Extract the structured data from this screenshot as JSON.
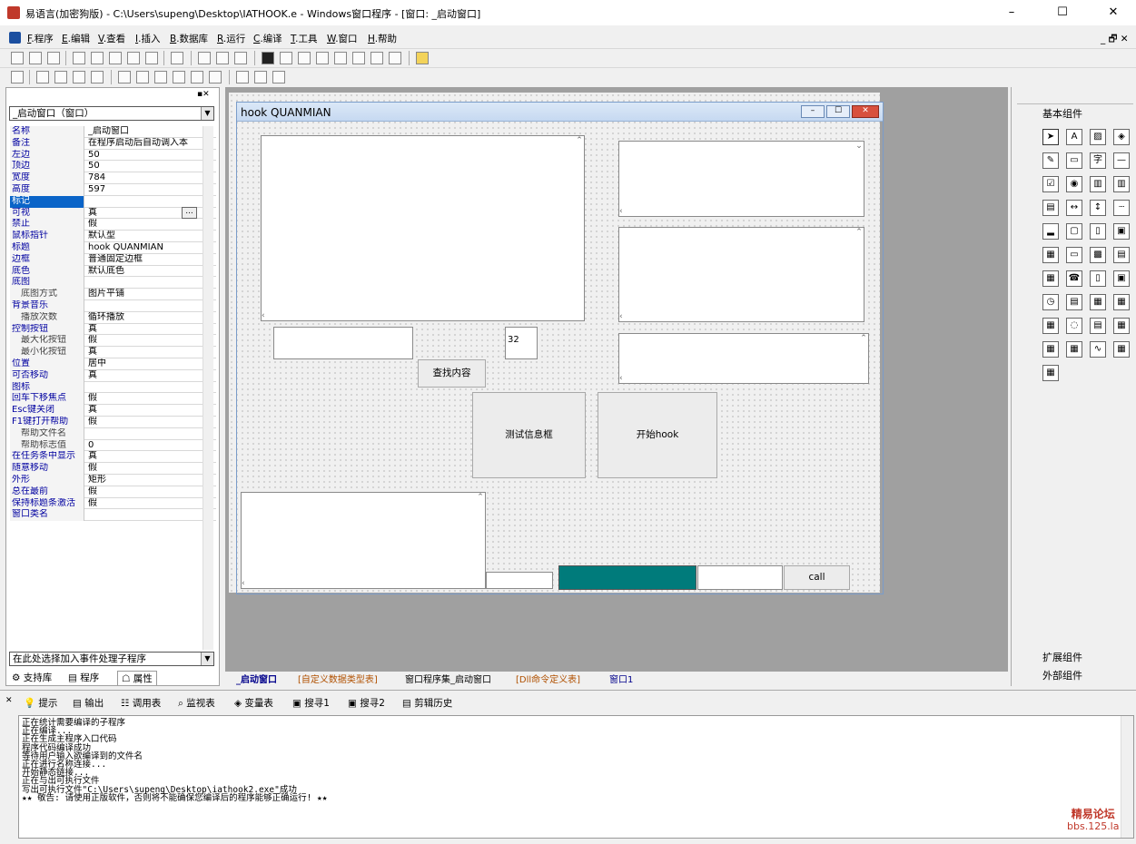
{
  "window": {
    "title": "易语言(加密狗版) - C:\\Users\\supeng\\Desktop\\IATHOOK.e - Windows窗口程序 - [窗口: _启动窗口]",
    "min": "–",
    "max": "☐",
    "close": "✕"
  },
  "menu": [
    {
      "key": "F",
      "label": ".程序"
    },
    {
      "key": "E",
      "label": ".编辑"
    },
    {
      "key": "V",
      "label": ".查看"
    },
    {
      "key": "I",
      "label": ".插入"
    },
    {
      "key": "B",
      "label": ".数据库"
    },
    {
      "key": "R",
      "label": ".运行"
    },
    {
      "key": "C",
      "label": ".编译"
    },
    {
      "key": "T",
      "label": ".工具"
    },
    {
      "key": "W",
      "label": ".窗口"
    },
    {
      "key": "H",
      "label": ".帮助"
    }
  ],
  "menu_right": "_ 🗗 ✕",
  "left": {
    "combo": "_启动窗口（窗口）",
    "props": [
      {
        "n": "名称",
        "v": "_启动窗口"
      },
      {
        "n": "备注",
        "v": "在程序启动后自动调入本"
      },
      {
        "n": "左边",
        "v": "50"
      },
      {
        "n": "顶边",
        "v": "50"
      },
      {
        "n": "宽度",
        "v": "784"
      },
      {
        "n": "高度",
        "v": "597"
      },
      {
        "n": "标记",
        "v": ""
      },
      {
        "n": "可视",
        "v": "真"
      },
      {
        "n": "禁止",
        "v": "假"
      },
      {
        "n": "鼠标指针",
        "v": "默认型"
      },
      {
        "n": "标题",
        "v": "hook QUANMIAN"
      },
      {
        "n": "边框",
        "v": "普通固定边框"
      },
      {
        "n": "底色",
        "v": "默认底色"
      },
      {
        "n": "底图",
        "v": ""
      },
      {
        "n": "底图方式",
        "v": "图片平铺"
      },
      {
        "n": "背景音乐",
        "v": ""
      },
      {
        "n": "播放次数",
        "v": "循环播放"
      },
      {
        "n": "控制按钮",
        "v": "真"
      },
      {
        "n": "最大化按钮",
        "v": "假"
      },
      {
        "n": "最小化按钮",
        "v": "真"
      },
      {
        "n": "位置",
        "v": "居中"
      },
      {
        "n": "可否移动",
        "v": "真"
      },
      {
        "n": "图标",
        "v": ""
      },
      {
        "n": "回车下移焦点",
        "v": "假"
      },
      {
        "n": "Esc键关闭",
        "v": "真"
      },
      {
        "n": "F1键打开帮助",
        "v": "假"
      },
      {
        "n": "帮助文件名",
        "v": ""
      },
      {
        "n": "帮助标志值",
        "v": "0"
      },
      {
        "n": "在任务条中显示",
        "v": "真"
      },
      {
        "n": "随意移动",
        "v": "假"
      },
      {
        "n": "外形",
        "v": "矩形"
      },
      {
        "n": "总在最前",
        "v": "假"
      },
      {
        "n": "保持标题条激活",
        "v": "假"
      },
      {
        "n": "窗口类名",
        "v": ""
      }
    ],
    "event_combo": "在此处选择加入事件处理子程序",
    "tabs": [
      "支持库",
      "程序",
      "属性"
    ]
  },
  "form": {
    "title": "hook QUANMIAN",
    "edit_num": "32",
    "btn_search": "查找内容",
    "btn_test": "测试信息框",
    "btn_hook": "开始hook",
    "btn_call": "call"
  },
  "doc_tabs": [
    "_启动窗口",
    "[自定义数据类型表]",
    "窗口程序集_启动窗口",
    "[Dll命令定义表]",
    "窗口1"
  ],
  "right": {
    "header": "基本组件",
    "ext": "扩展组件",
    "ext2": "外部组件"
  },
  "output_tabs": [
    "提示",
    "输出",
    "调用表",
    "监视表",
    "变量表",
    "搜寻1",
    "搜寻2",
    "剪辑历史"
  ],
  "output_lines": [
    "正在统计需要编译的子程序",
    "正在编译...",
    "正在生成主程序入口代码",
    "程序代码编译成功",
    "等待用户输入欲编译到的文件名",
    "正在进行名称连接...",
    "开始静态链接...",
    "正在与出可执行文件",
    "写出可执行文件\"C:\\Users\\supeng\\Desktop\\iathook2.exe\"成功",
    "★★ 敬告: 请使用正版软件，否则将不能确保您编译后的程序能够正确运行! ★★"
  ],
  "watermark": [
    "精易论坛",
    "bbs.125.la"
  ]
}
